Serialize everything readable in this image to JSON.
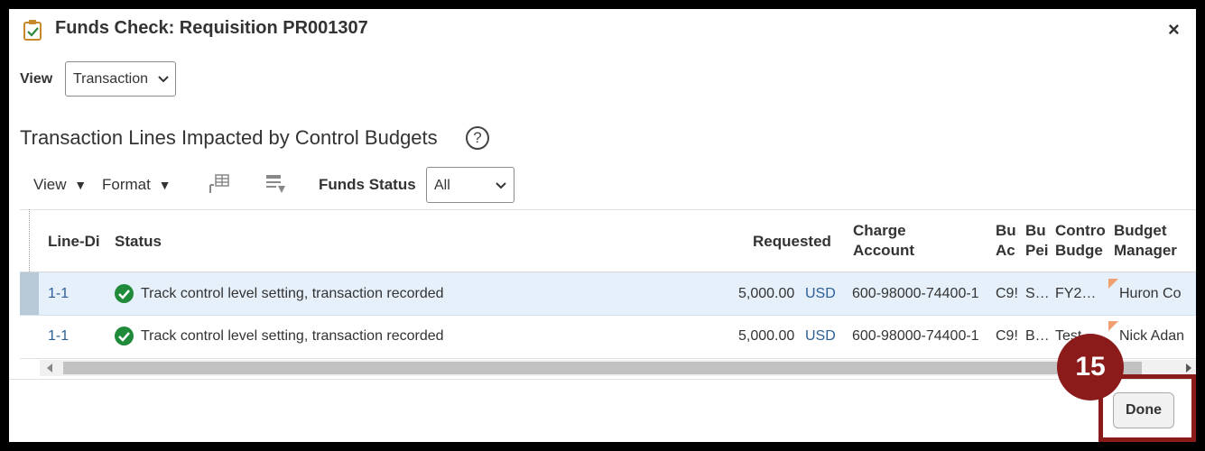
{
  "dialog": {
    "title": "Funds Check: Requisition PR001307",
    "close": "×"
  },
  "view_selector": {
    "label": "View",
    "value": "Transaction"
  },
  "section": {
    "title": "Transaction Lines Impacted by Control Budgets",
    "help": "?"
  },
  "toolbar": {
    "view_label": "View",
    "format_label": "Format",
    "funds_status_label": "Funds Status",
    "funds_status_value": "All"
  },
  "table": {
    "headers": {
      "line": "Line-Di",
      "status": "Status",
      "requested": "Requested",
      "charge_1": "Charge",
      "charge_2": "Account",
      "bu1_1": "Bu",
      "bu1_2": "Ac",
      "bu2_1": "Bu",
      "bu2_2": "Pei",
      "control_1": "Contro",
      "control_2": "Budge",
      "manager_1": "Budget",
      "manager_2": "Manager"
    },
    "rows": [
      {
        "line": "1-1",
        "status": "Track control level setting, transaction recorded",
        "amount": "5,000.00",
        "currency": "USD",
        "account": "600-98000-74400-1",
        "c1": "C9!",
        "c2": "S…",
        "c3": "FY2…",
        "manager": "Huron Co"
      },
      {
        "line": "1-1",
        "status": "Track control level setting, transaction recorded",
        "amount": "5,000.00",
        "currency": "USD",
        "account": "600-98000-74400-1",
        "c1": "C9!",
        "c2": "B…",
        "c3": "Test",
        "manager": "Nick Adan"
      }
    ]
  },
  "footer": {
    "done_label": "Done",
    "step_badge": "15"
  }
}
